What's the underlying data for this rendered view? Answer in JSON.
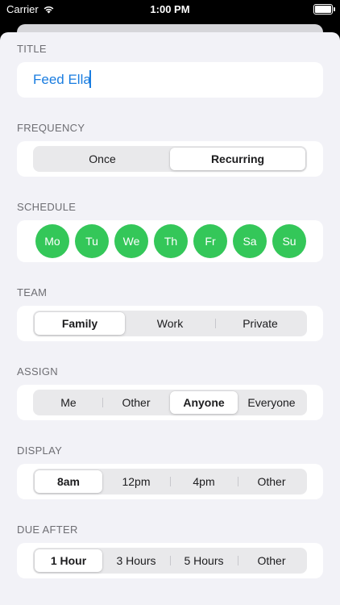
{
  "status": {
    "carrier": "Carrier",
    "time": "1:00 PM"
  },
  "title": {
    "header": "TITLE",
    "value": "Feed Ella"
  },
  "frequency": {
    "header": "FREQUENCY",
    "options": [
      "Once",
      "Recurring"
    ],
    "selected": "Recurring"
  },
  "schedule": {
    "header": "SCHEDULE",
    "days": [
      "Mo",
      "Tu",
      "We",
      "Th",
      "Fr",
      "Sa",
      "Su"
    ],
    "color": "#34c759"
  },
  "team": {
    "header": "TEAM",
    "options": [
      "Family",
      "Work",
      "Private"
    ],
    "selected": "Family"
  },
  "assign": {
    "header": "ASSIGN",
    "options": [
      "Me",
      "Other",
      "Anyone",
      "Everyone"
    ],
    "selected": "Anyone"
  },
  "display": {
    "header": "DISPLAY",
    "options": [
      "8am",
      "12pm",
      "4pm",
      "Other"
    ],
    "selected": "8am"
  },
  "due_after": {
    "header": "DUE AFTER",
    "options": [
      "1 Hour",
      "3 Hours",
      "5 Hours",
      "Other"
    ],
    "selected": "1 Hour"
  },
  "colors": {
    "accent": "#1a7de0",
    "day_green": "#34c759",
    "background": "#f2f2f7"
  }
}
